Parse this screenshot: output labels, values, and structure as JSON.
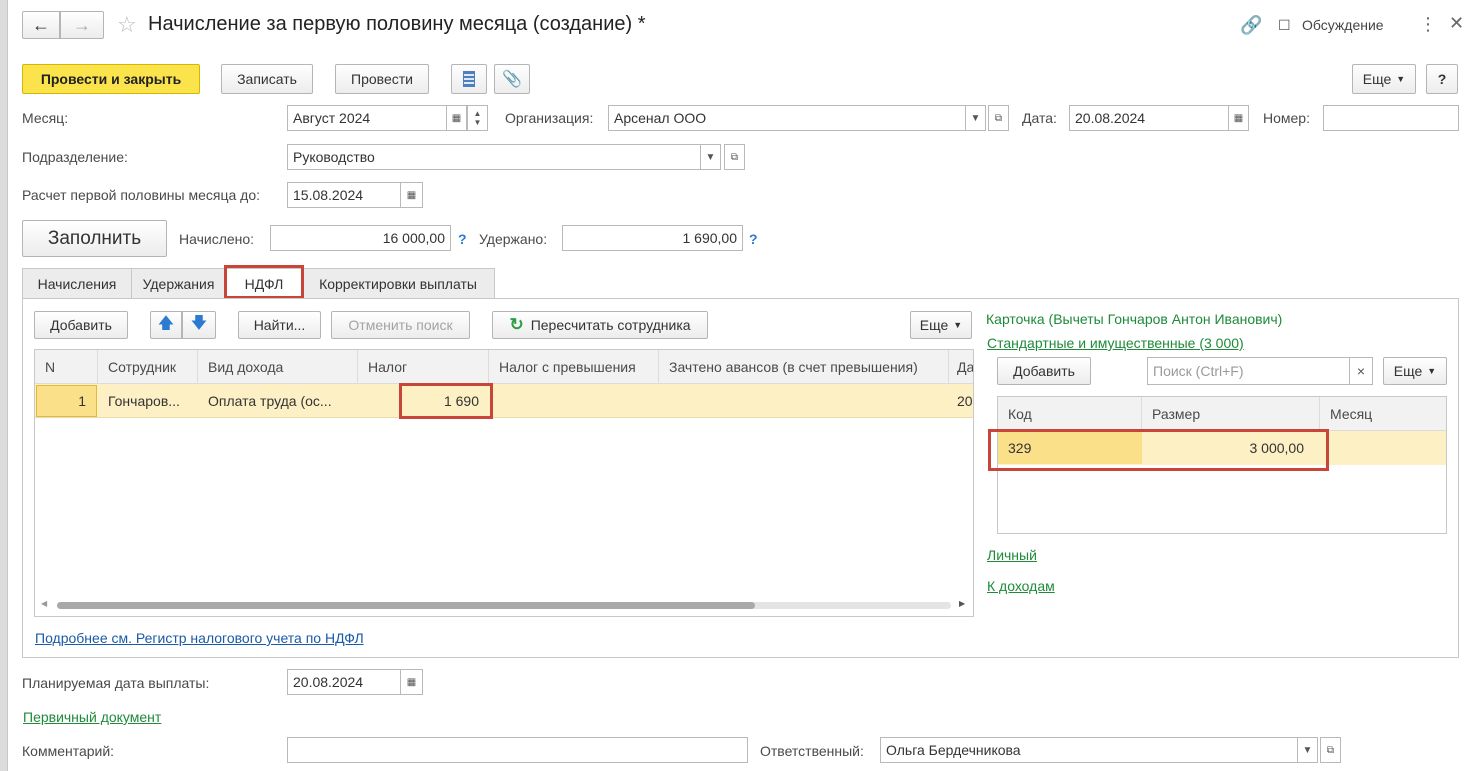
{
  "window": {
    "title": "Начисление за первую половину месяца (создание) *",
    "discussion_label": "Обсуждение"
  },
  "toolbar": {
    "post_close": "Провести и закрыть",
    "save": "Записать",
    "post": "Провести",
    "more": "Еще",
    "help": "?"
  },
  "form": {
    "month_label": "Месяц:",
    "month_value": "Август 2024",
    "org_label": "Организация:",
    "org_value": "Арсенал ООО",
    "date_label": "Дата:",
    "date_value": "20.08.2024",
    "number_label": "Номер:",
    "number_value": "",
    "dept_label": "Подразделение:",
    "dept_value": "Руководство",
    "calc_label": "Расчет первой половины месяца до:",
    "calc_value": "15.08.2024",
    "fill_button": "Заполнить",
    "accrued_label": "Начислено:",
    "accrued_value": "16 000,00",
    "withheld_label": "Удержано:",
    "withheld_value": "1 690,00",
    "help_mark": "?"
  },
  "tabs": [
    {
      "label": "Начисления"
    },
    {
      "label": "Удержания"
    },
    {
      "label": "НДФЛ"
    },
    {
      "label": "Корректировки выплаты"
    }
  ],
  "ndfl": {
    "add": "Добавить",
    "find": "Найти...",
    "cancel_search": "Отменить поиск",
    "recalc": "Пересчитать сотрудника",
    "more": "Еще",
    "columns": [
      "N",
      "Сотрудник",
      "Вид дохода",
      "Налог",
      "Налог с превышения",
      "Зачтено авансов (в счет превышения)",
      "Да"
    ],
    "rows": [
      {
        "n": "1",
        "employee": "Гончаров...",
        "income": "Оплата труда (ос...",
        "tax": "1 690",
        "tax_excess": "",
        "advances": "",
        "date": "20"
      }
    ],
    "footer_link": "Подробнее см. Регистр налогового учета по НДФЛ"
  },
  "card": {
    "title": "Карточка (Вычеты Гончаров Антон Иванович)",
    "std_link": "Стандартные и имущественные (3 000)",
    "add": "Добавить",
    "search_placeholder": "Поиск (Ctrl+F)",
    "clear": "×",
    "more": "Еще",
    "columns": [
      "Код",
      "Размер",
      "Месяц"
    ],
    "rows": [
      {
        "code": "329",
        "size": "3 000,00",
        "month": ""
      }
    ],
    "personal_link": "Личный",
    "income_link": "К доходам"
  },
  "bottom": {
    "paydate_label": "Планируемая дата выплаты:",
    "paydate_value": "20.08.2024",
    "primary_doc_link": "Первичный документ",
    "comment_label": "Комментарий:",
    "comment_value": "",
    "responsible_label": "Ответственный:",
    "responsible_value": "Ольга Бердечникова"
  },
  "colors": {
    "accent_yellow": "#fbe34c",
    "link_green": "#1f8a3a",
    "link_blue": "#1a5aa6",
    "highlight_red": "#c8453a",
    "row_selected": "#fdf0c4"
  }
}
